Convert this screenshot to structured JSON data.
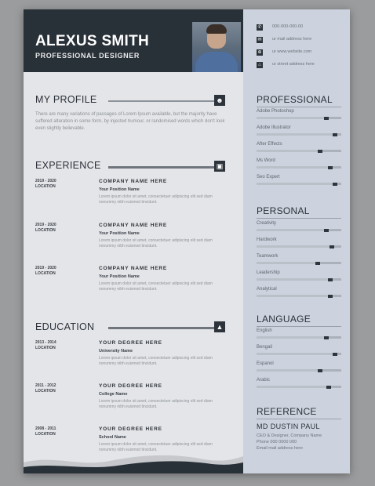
{
  "resume": {
    "name": "ALEXUS SMITH",
    "role": "PROFESSIONAL DESIGNER",
    "profile": {
      "title": "MY PROFILE",
      "text": "There are many variations of passages of Lorem Ipsum available, but the majority have suffered alteration in some form, by injected humour, or randomised words which don't look even slightly believable."
    },
    "experience": {
      "title": "EXPERIENCE",
      "items": [
        {
          "date": "2019 - 2020",
          "location": "LOCATION",
          "title": "COMPANY NAME HERE",
          "sub": "Your Position Name",
          "desc": "Lorem ipsum dolor sit amet, consectetuer adipiscing elit sed diam nonummy nibh euismod tincidunt."
        },
        {
          "date": "2019 - 2020",
          "location": "LOCATION",
          "title": "COMPANY NAME HERE",
          "sub": "Your Position Name",
          "desc": "Lorem ipsum dolor sit amet, consectetuer adipiscing elit sed diam nonummy nibh euismod tincidunt."
        },
        {
          "date": "2019 - 2020",
          "location": "LOCATION",
          "title": "COMPANY NAME HERE",
          "sub": "Your Position Name",
          "desc": "Lorem ipsum dolor sit amet, consectetuer adipiscing elit sed diam nonummy nibh euismod tincidunt."
        }
      ]
    },
    "education": {
      "title": "EDUCATION",
      "items": [
        {
          "date": "2013 - 2014",
          "location": "LOCATION",
          "title": "YOUR DEGREE HERE",
          "sub": "University Name",
          "desc": "Lorem ipsum dolor sit amet, consectetuer adipiscing elit sed diam nonummy nibh euismod tincidunt."
        },
        {
          "date": "2011 - 2012",
          "location": "LOCATION",
          "title": "YOUR DEGREE HERE",
          "sub": "College Name",
          "desc": "Lorem ipsum dolor sit amet, consectetuer adipiscing elit sed diam nonummy nibh euismod tincidunt."
        },
        {
          "date": "2008 - 2011",
          "location": "LOCATION",
          "title": "YOUR DEGREE HERE",
          "sub": "School Name",
          "desc": "Lorem ipsum dolor sit amet, consectetuer adipiscing elit sed diam nonummy nibh euismod tincidunt."
        }
      ]
    },
    "contact": [
      {
        "icon": "phone-icon",
        "glyph": "✆",
        "text": "000-000-000-00"
      },
      {
        "icon": "mail-icon",
        "glyph": "✉",
        "text": "ur mail address here"
      },
      {
        "icon": "web-icon",
        "glyph": "⊕",
        "text": "ur www.website.com"
      },
      {
        "icon": "location-icon",
        "glyph": "⌂",
        "text": "ur street address here"
      }
    ],
    "professional": {
      "title": "PROFESSIONAL",
      "skills": [
        {
          "label": "Adobe Photoshop",
          "level": 0.85
        },
        {
          "label": "Adobe Illustrator",
          "level": 0.95
        },
        {
          "label": "After Effects",
          "level": 0.78
        },
        {
          "label": "Ms Word",
          "level": 0.9
        },
        {
          "label": "Seo Expert",
          "level": 0.95
        }
      ]
    },
    "personal": {
      "title": "PERSONAL",
      "skills": [
        {
          "label": "Creativity",
          "level": 0.85
        },
        {
          "label": "Hardwork",
          "level": 0.92
        },
        {
          "label": "Teamwork",
          "level": 0.75
        },
        {
          "label": "Leadership",
          "level": 0.9
        },
        {
          "label": "Analytical",
          "level": 0.9
        }
      ]
    },
    "language": {
      "title": "LANGUAGE",
      "skills": [
        {
          "label": "English",
          "level": 0.85
        },
        {
          "label": "Bengali",
          "level": 0.95
        },
        {
          "label": "Espanol",
          "level": 0.78
        },
        {
          "label": "Arabic",
          "level": 0.88
        }
      ]
    },
    "reference": {
      "title": "REFERENCE",
      "name": "MD DUSTIN PAUL",
      "lines": [
        "CEO & Designer, Company Name",
        "Phone 000 0000 000",
        "Email mail address here"
      ]
    },
    "colors": {
      "header": "#283038",
      "sidebar": "#ccd3de",
      "page": "#e4e5e8"
    }
  }
}
